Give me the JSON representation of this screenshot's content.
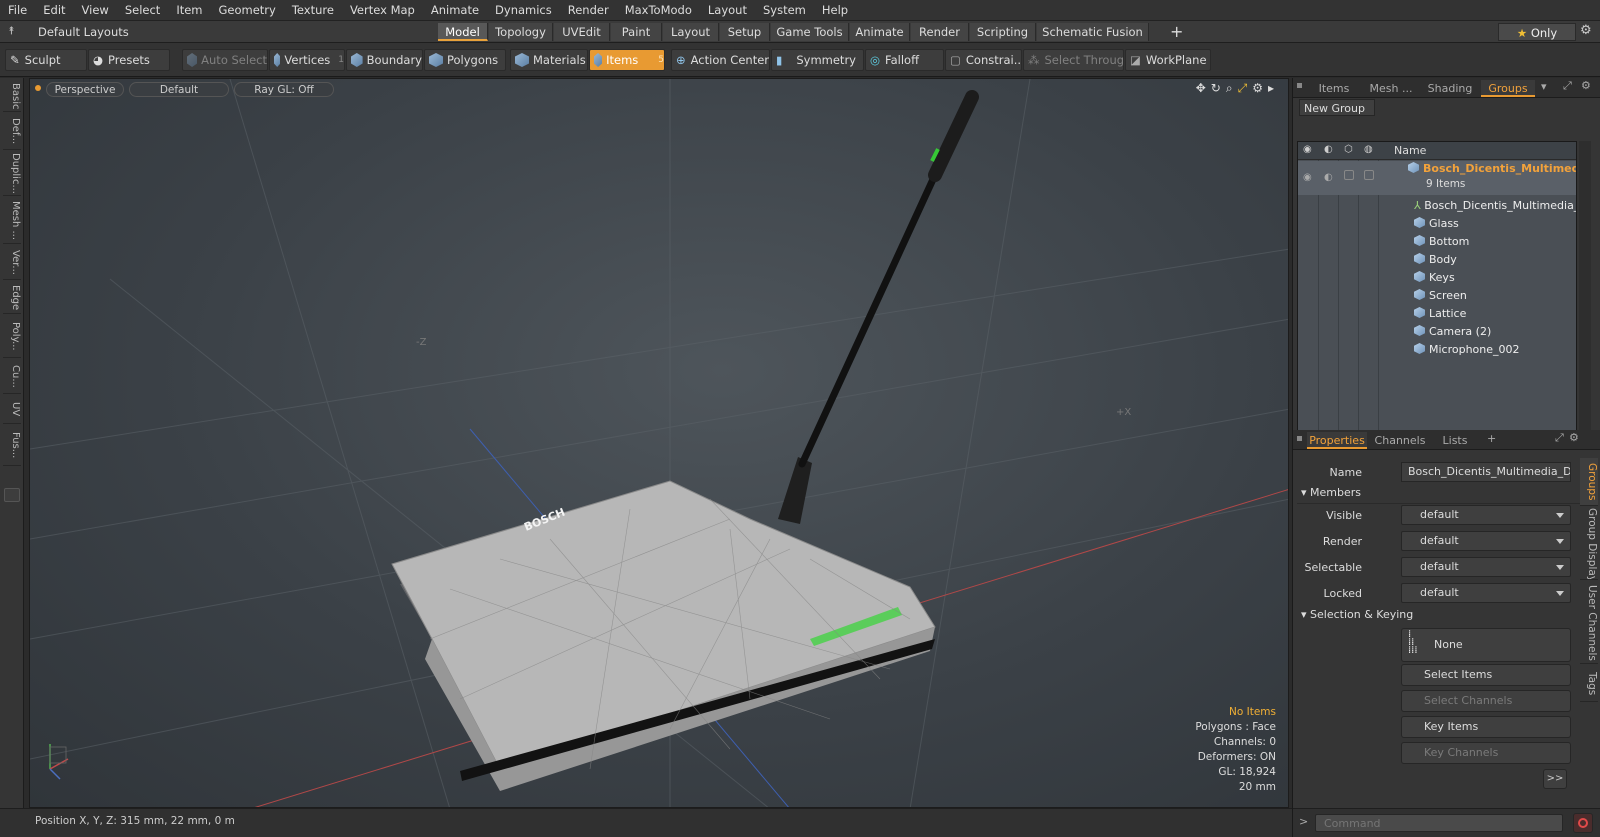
{
  "menu": [
    "File",
    "Edit",
    "View",
    "Select",
    "Item",
    "Geometry",
    "Texture",
    "Vertex Map",
    "Animate",
    "Dynamics",
    "Render",
    "MaxToModo",
    "Layout",
    "System",
    "Help"
  ],
  "layout": {
    "preset": "Default Layouts",
    "tabs": [
      "Model",
      "Topology",
      "UVEdit",
      "Paint",
      "Layout",
      "Setup",
      "Game Tools",
      "Animate",
      "Render",
      "Scripting",
      "Schematic Fusion"
    ],
    "active_tab": "Model",
    "only_label": "Only"
  },
  "toolbar": {
    "sculpt": "Sculpt",
    "presets": "Presets",
    "auto_select": "Auto Select",
    "vertices": "Vertices",
    "vertices_count": "1",
    "boundary": "Boundary",
    "polygons": "Polygons",
    "materials": "Materials",
    "items": "Items",
    "items_count": "5",
    "action_center": "Action Center",
    "symmetry": "Symmetry",
    "falloff": "Falloff",
    "constraints": "Constrai...",
    "select_through": "Select Through",
    "workplane": "WorkPlane"
  },
  "left_tabs": [
    "Basic",
    "Def...",
    "Duplic...",
    "Mesh ...",
    "Ver...",
    "Edge",
    "Poly...",
    "Cu...",
    "UV",
    "Fus..."
  ],
  "viewport": {
    "view": "Perspective",
    "shading": "Default",
    "raygl": "Ray GL: Off",
    "axis_minus_z": "-Z",
    "axis_plus_x": "+X",
    "brand_text": "BOSCH",
    "info": {
      "selection": "No Items",
      "polygons": "Polygons : Face",
      "channels": "Channels: 0",
      "deformers": "Deformers: ON",
      "gl": "GL: 18,924",
      "scale": "20 mm"
    }
  },
  "status": "Position X, Y, Z:   315 mm, 22 mm, 0 m",
  "outliner": {
    "tabs": [
      "Items",
      "Mesh ...",
      "Shading",
      "Groups"
    ],
    "active_tab": "Groups",
    "new_group": "New Group",
    "name_header": "Name",
    "group_name": "Bosch_Dicentis_Multimed ...",
    "group_count": "9 Items",
    "items": [
      "Bosch_Dicentis_Multimedia_...",
      "Glass",
      "Bottom",
      "Body",
      "Keys",
      "Screen",
      "Lattice",
      "Camera (2)",
      "Microphone_002"
    ]
  },
  "properties": {
    "tabs": [
      "Properties",
      "Channels",
      "Lists"
    ],
    "active_tab": "Properties",
    "name_label": "Name",
    "name_value": "Bosch_Dicentis_Multimedia_Devic",
    "members_header": "Members",
    "fields": [
      {
        "label": "Visible",
        "value": "default"
      },
      {
        "label": "Render",
        "value": "default"
      },
      {
        "label": "Selectable",
        "value": "default"
      },
      {
        "label": "Locked",
        "value": "default"
      }
    ],
    "keying_header": "Selection & Keying",
    "none_label": "None",
    "select_items": "Select Items",
    "select_channels": "Select Channels",
    "key_items": "Key Items",
    "key_channels": "Key Channels",
    "more": ">>",
    "side_tabs": [
      "Groups",
      "Group Display",
      "User Channels",
      "Tags"
    ],
    "command_placeholder": "Command"
  }
}
